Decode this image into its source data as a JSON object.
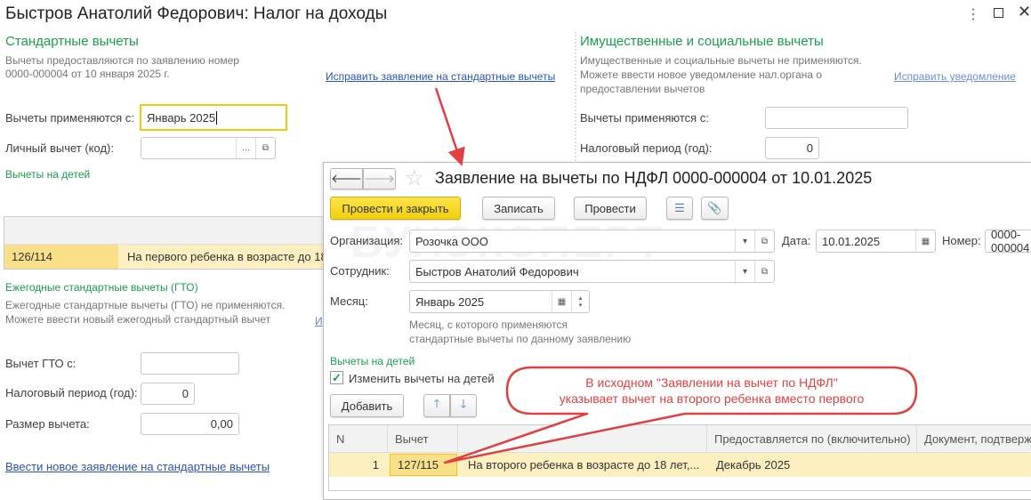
{
  "window": {
    "title": "Быстров Анатолий Федорович: Налог на доходы",
    "controls": [
      "more-icon",
      "maximize-icon",
      "close-icon"
    ]
  },
  "standard": {
    "heading": "Стандартные вычеты",
    "info_line1": "Вычеты предоставляются по заявлению номер",
    "info_line2": "0000-000004 от 10 января 2025 г.",
    "fix_link": "Исправить заявление на стандартные вычеты",
    "applied_from_label": "Вычеты применяются с:",
    "applied_from_value": "Январь 2025",
    "personal_label": "Личный вычет (код):",
    "personal_value": "",
    "children_heading": "Вычеты на детей",
    "children_rows": [
      {
        "code": "126/114",
        "description": "На первого ребенка в возрасте до 18"
      }
    ]
  },
  "gto": {
    "heading": "Ежегодные стандартные вычеты (ГТО)",
    "info_line1": "Ежегодные стандартные вычеты (ГТО) не применяются.",
    "info_line2": "Можете ввести новый ежегодный стандартный вычет",
    "link_partial": "И",
    "from_label": "Вычет ГТО с:",
    "from_value": "",
    "period_label": "Налоговый период (год):",
    "period_value": "0",
    "size_label": "Размер вычета:",
    "size_value": "0,00",
    "new_link": "Ввести новое заявление на стандартные вычеты"
  },
  "property": {
    "heading": "Имущественные и социальные вычеты",
    "info_line1": "Имущественные и социальные вычеты не применяются.",
    "info_line2": "Можете ввести новое уведомление нал.органа о",
    "info_line3": "предоставлении вычетов",
    "fix_link": "Исправить уведомление",
    "applied_from_label": "Вычеты применяются с:",
    "applied_from_value": "",
    "period_label": "Налоговый период (год):",
    "period_value": "0"
  },
  "modal": {
    "title": "Заявление на вычеты по НДФЛ 0000-000004 от 10.01.2025",
    "post_close": "Провести и закрыть",
    "save": "Записать",
    "post": "Провести",
    "org_label": "Организация:",
    "org_value": "Розочка ООО",
    "date_label": "Дата:",
    "date_value": "10.01.2025",
    "number_label": "Номер:",
    "number_value": "0000-000004",
    "employee_label": "Сотрудник:",
    "employee_value": "Быстров Анатолий Федорович",
    "month_label": "Месяц:",
    "month_value": "Январь 2025",
    "month_hint1": "Месяц, с которого применяются",
    "month_hint2": "стандартные вычеты по данному заявлению",
    "children_heading": "Вычеты на детей",
    "change_children_label": "Изменить вычеты на детей",
    "change_children_checked": true,
    "add": "Добавить",
    "table": {
      "headers": [
        "N",
        "Вычет",
        "",
        "Предоставляется по (включительно)",
        "Документ, подтверж"
      ],
      "rows": [
        {
          "n": "1",
          "code": "127/115",
          "description": "На второго ребенка в возрасте до 18 лет,...",
          "until": "Декабрь 2025",
          "document": ""
        }
      ]
    }
  },
  "callout": {
    "line1": "В исходном \"Заявлении на вычет по НДФЛ\"",
    "line2": "указывает вычет на второго ребенка вместо первого"
  },
  "watermark": "БУХЭКСПЕРТ",
  "colors": {
    "accent_green": "#1a9e4a",
    "link": "#2a55b5",
    "primary_button": "#f5d523",
    "selected_row": "#fcf0c0",
    "annotation": "#e04040"
  }
}
